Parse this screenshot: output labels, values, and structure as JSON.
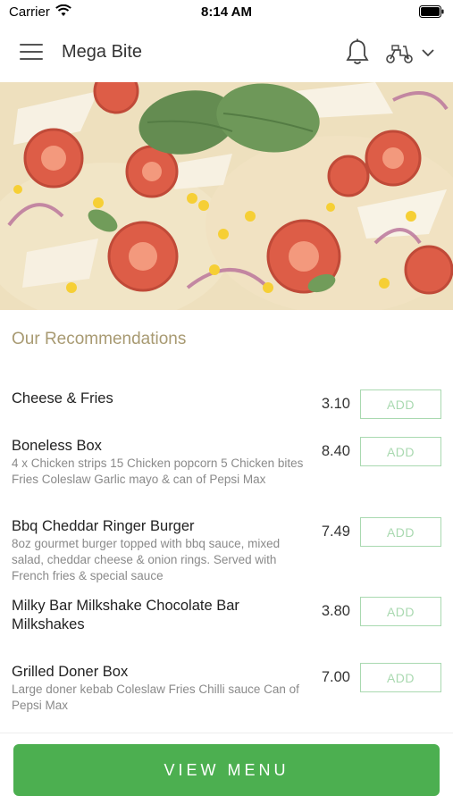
{
  "status_bar": {
    "carrier": "Carrier",
    "time": "8:14 AM"
  },
  "header": {
    "title": "Mega Bite",
    "icons": [
      "menu-icon",
      "bell-icon",
      "scooter-icon",
      "chevron-down-icon"
    ]
  },
  "hero": {
    "image": "pizza-photo"
  },
  "recommendations": {
    "title": "Our Recommendations",
    "items": [
      {
        "name": "Cheese & Fries",
        "description": "",
        "price": "3.10",
        "add_label": "ADD"
      },
      {
        "name": "Boneless Box",
        "description": "4 x Chicken strips  15 Chicken popcorn  5 Chicken bites  Fries  Coleslaw  Garlic mayo & can of Pepsi Max",
        "price": "8.40",
        "add_label": "ADD"
      },
      {
        "name": "Bbq Cheddar Ringer Burger",
        "description": "8oz gourmet burger topped with bbq sauce, mixed salad, cheddar cheese & onion rings. Served with French fries & special sauce",
        "price": "7.49",
        "add_label": "ADD"
      },
      {
        "name": "Milky Bar Milkshake Chocolate Bar Milkshakes",
        "description": "",
        "price": "3.80",
        "add_label": "ADD"
      },
      {
        "name": "Grilled Doner Box",
        "description": "Large doner kebab  Coleslaw  Fries  Chilli sauce  Can of Pepsi Max",
        "price": "7.00",
        "add_label": "ADD"
      }
    ]
  },
  "footer": {
    "view_menu_label": "VIEW MENU"
  },
  "colors": {
    "accent_green": "#4caf50",
    "add_border": "#a9d9b0",
    "section_title": "#a89a72"
  }
}
